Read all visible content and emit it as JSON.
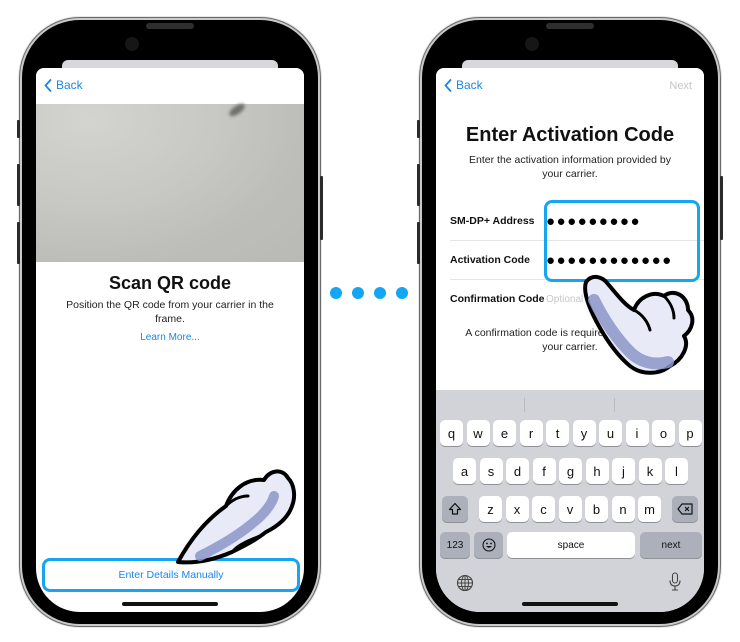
{
  "connector": {
    "dot_count": 4,
    "color": "#12a6f4"
  },
  "left_screen": {
    "nav": {
      "back_label": "Back"
    },
    "title": "Scan QR code",
    "subtitle": "Position the QR code from your carrier in the frame.",
    "learn_more": "Learn More...",
    "enter_manual_label": "Enter Details Manually",
    "highlight_color": "#17a5f2"
  },
  "right_screen": {
    "nav": {
      "back_label": "Back",
      "next_label": "Next"
    },
    "title": "Enter Activation Code",
    "subtitle": "Enter the activation information provided by your carrier.",
    "fields": [
      {
        "label": "SM-DP+ Address",
        "value": "●●●●●●●●●"
      },
      {
        "label": "Activation Code",
        "value": "●●●●●●●●●●●●"
      },
      {
        "label": "Confirmation Code",
        "placeholder": "Optional"
      }
    ],
    "note": "A confirmation code is required if provided by your carrier.",
    "keyboard": {
      "row1": [
        "q",
        "w",
        "e",
        "r",
        "t",
        "y",
        "u",
        "i",
        "o",
        "p"
      ],
      "row2": [
        "a",
        "s",
        "d",
        "f",
        "g",
        "h",
        "j",
        "k",
        "l"
      ],
      "row3": [
        "z",
        "x",
        "c",
        "v",
        "b",
        "n",
        "m"
      ],
      "numbers_label": "123",
      "space_label": "space",
      "next_label": "next"
    }
  }
}
